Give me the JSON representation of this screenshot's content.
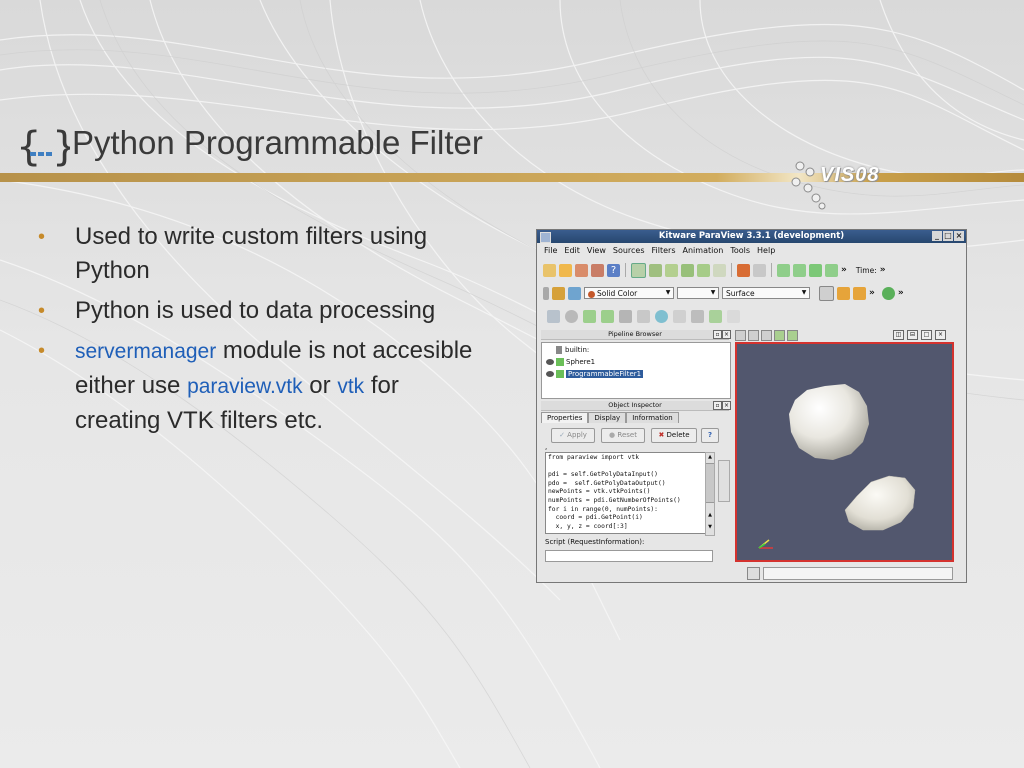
{
  "slide": {
    "title": "Python Programmable Filter",
    "logo_text": "VIS08",
    "bullets": [
      {
        "text": "Used to write custom filters using Python"
      },
      {
        "text": "Python is used to data processing"
      },
      {
        "parts": [
          "servermanager",
          " module is not accesible either use ",
          "paraview.vtk",
          " or ",
          "vtk",
          " for creating VTK filters etc."
        ]
      }
    ],
    "colors": {
      "bullet": "#c68a2a",
      "accent_text": "#1f5fb8",
      "gold_bar": "#c9a04a"
    }
  },
  "paraview": {
    "window_title": "Kitware ParaView 3.3.1 (development)",
    "window_buttons": [
      "_",
      "□",
      "×"
    ],
    "menu": [
      "File",
      "Edit",
      "View",
      "Sources",
      "Filters",
      "Animation",
      "Tools",
      "Help"
    ],
    "toolbar1": {
      "time_label": "Time:",
      "more": "»"
    },
    "toolbar2": {
      "color_combo": "Solid Color",
      "repr_combo": "Surface",
      "more": "»"
    },
    "pipeline_browser": {
      "header": "Pipeline Browser",
      "items": [
        "builtin:",
        "Sphere1",
        "ProgrammableFilter1"
      ]
    },
    "object_inspector": {
      "header": "Object Inspector",
      "tabs": [
        "Properties",
        "Display",
        "Information"
      ],
      "buttons": {
        "apply": "Apply",
        "reset": "Reset",
        "delete": "Delete",
        "help": "?"
      },
      "script_code": "from paraview import vtk\n\npdi = self.GetPolyDataInput()\npdo =  self.GetPolyDataOutput()\nnewPoints = vtk.vtkPoints()\nnumPoints = pdi.GetNumberOfPoints()\nfor i in range(0, numPoints):\n  coord = pdi.GetPoint(i)\n  x, y, z = coord[:3]",
      "script_request_label": "Script (RequestInformation):"
    },
    "viewport": {
      "background": "#52576e",
      "border": "#d4322e"
    }
  }
}
